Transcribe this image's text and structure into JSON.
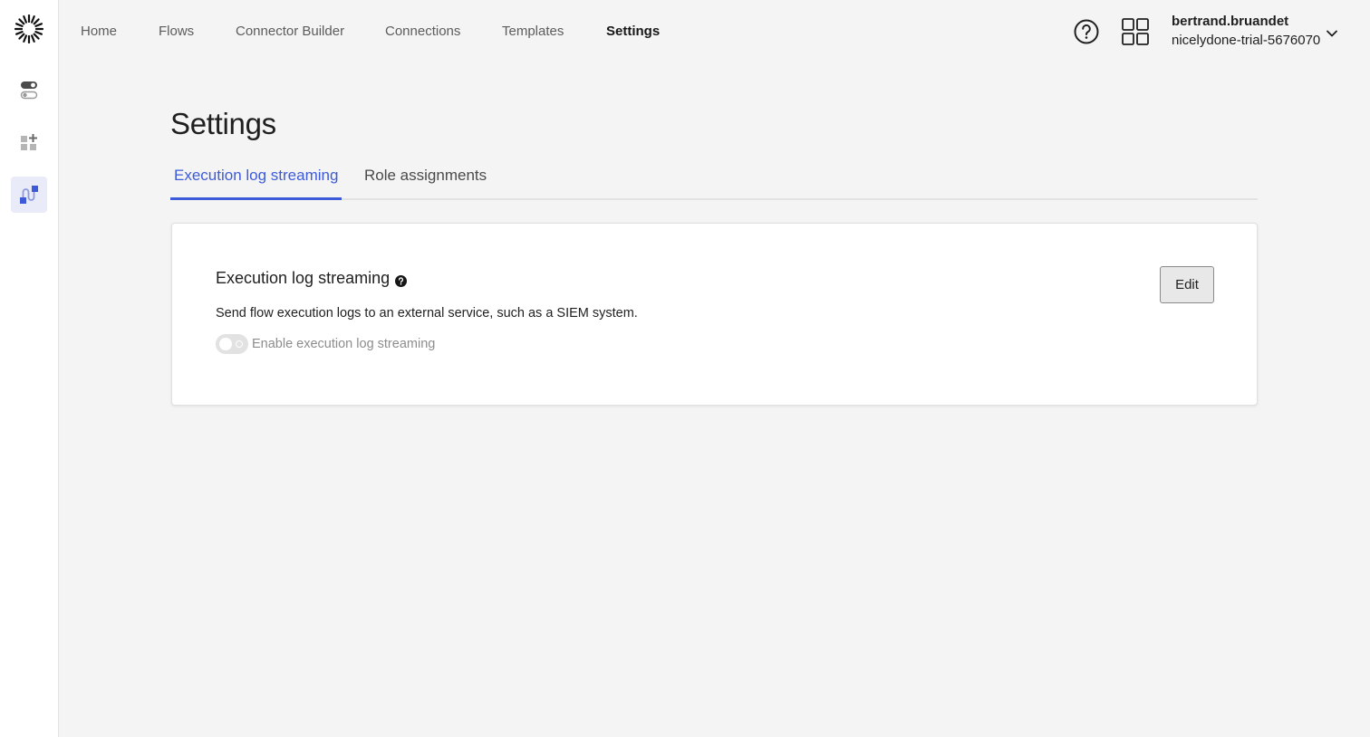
{
  "nav": {
    "items": [
      {
        "label": "Home",
        "active": false
      },
      {
        "label": "Flows",
        "active": false
      },
      {
        "label": "Connector Builder",
        "active": false
      },
      {
        "label": "Connections",
        "active": false
      },
      {
        "label": "Templates",
        "active": false
      },
      {
        "label": "Settings",
        "active": true
      }
    ]
  },
  "account": {
    "username": "bertrand.bruandet",
    "tenant": "nicelydone-trial-5676070"
  },
  "sidebar": {
    "icons": [
      "toggles-icon",
      "add-apps-icon",
      "integration-icon"
    ],
    "active_index": 2
  },
  "page": {
    "title": "Settings",
    "tabs": [
      {
        "label": "Execution log streaming",
        "active": true
      },
      {
        "label": "Role assignments",
        "active": false
      }
    ]
  },
  "card": {
    "title": "Execution log streaming",
    "description": "Send flow execution logs to an external service, such as a SIEM system.",
    "toggle_label": "Enable execution log streaming",
    "toggle_enabled": false,
    "edit_label": "Edit"
  },
  "colors": {
    "accent": "#3d5bd9",
    "background": "#f4f4f4"
  }
}
